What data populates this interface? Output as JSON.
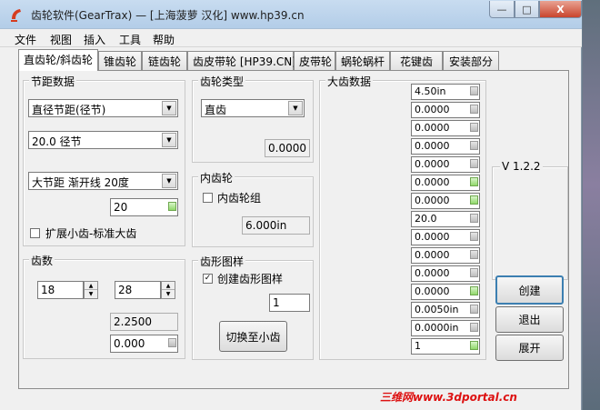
{
  "window": {
    "title": "齿轮软件(GearTrax) — [上海菠萝 汉化] www.hp39.cn",
    "minimize": "—",
    "maximize": "□",
    "close": "X"
  },
  "menu": [
    "文件",
    "视图",
    "插入",
    "工具",
    "帮助"
  ],
  "tabs": [
    "直齿轮/斜齿轮",
    "锥齿轮",
    "链齿轮",
    "齿皮带轮 [HP39.CN]",
    "皮带轮",
    "蜗轮蜗杆",
    "花键齿",
    "安装部分"
  ],
  "pitch": {
    "title": "节距数据",
    "type_select": "直径节距(径节)",
    "pitch_select": "20.0 径节",
    "angle_select": "大节距 渐开线 20度",
    "angle_value": "20",
    "extend_label": "扩展小齿-标准大齿"
  },
  "teeth": {
    "title": "齿数",
    "pinion": "18",
    "gear": "28",
    "ratio": "2.2500",
    "extra": "0.000"
  },
  "gear_type": {
    "title": "齿轮类型",
    "select": "直齿",
    "value": "0.0000"
  },
  "internal": {
    "title": "内齿轮",
    "checkbox_label": "内齿轮组",
    "value": "6.000in"
  },
  "profile": {
    "title": "齿形图样",
    "checkbox_label": "创建齿形图样",
    "value": "1",
    "switch_button": "切换至小齿"
  },
  "big_gear": {
    "title": "大齿数据",
    "rows": [
      {
        "value": "4.50in",
        "active": false
      },
      {
        "value": "0.0000",
        "active": false
      },
      {
        "value": "0.0000",
        "active": false
      },
      {
        "value": "0.0000",
        "active": false
      },
      {
        "value": "0.0000",
        "active": false
      },
      {
        "value": "0.0000",
        "active": true
      },
      {
        "value": "0.0000",
        "active": true
      },
      {
        "value": "20.0",
        "active": false
      },
      {
        "value": "0.0000",
        "active": false
      },
      {
        "value": "0.0000",
        "active": false
      },
      {
        "value": "0.0000",
        "active": false
      },
      {
        "value": "0.0000",
        "active": true
      },
      {
        "value": "0.0050in",
        "active": false
      },
      {
        "value": "0.0000in",
        "active": false
      },
      {
        "value": "1",
        "active": true
      }
    ]
  },
  "version": "V 1.2.2",
  "buttons": {
    "create": "创建",
    "exit": "退出",
    "expand": "展开"
  },
  "watermark": "三维网www.3dportal.cn"
}
